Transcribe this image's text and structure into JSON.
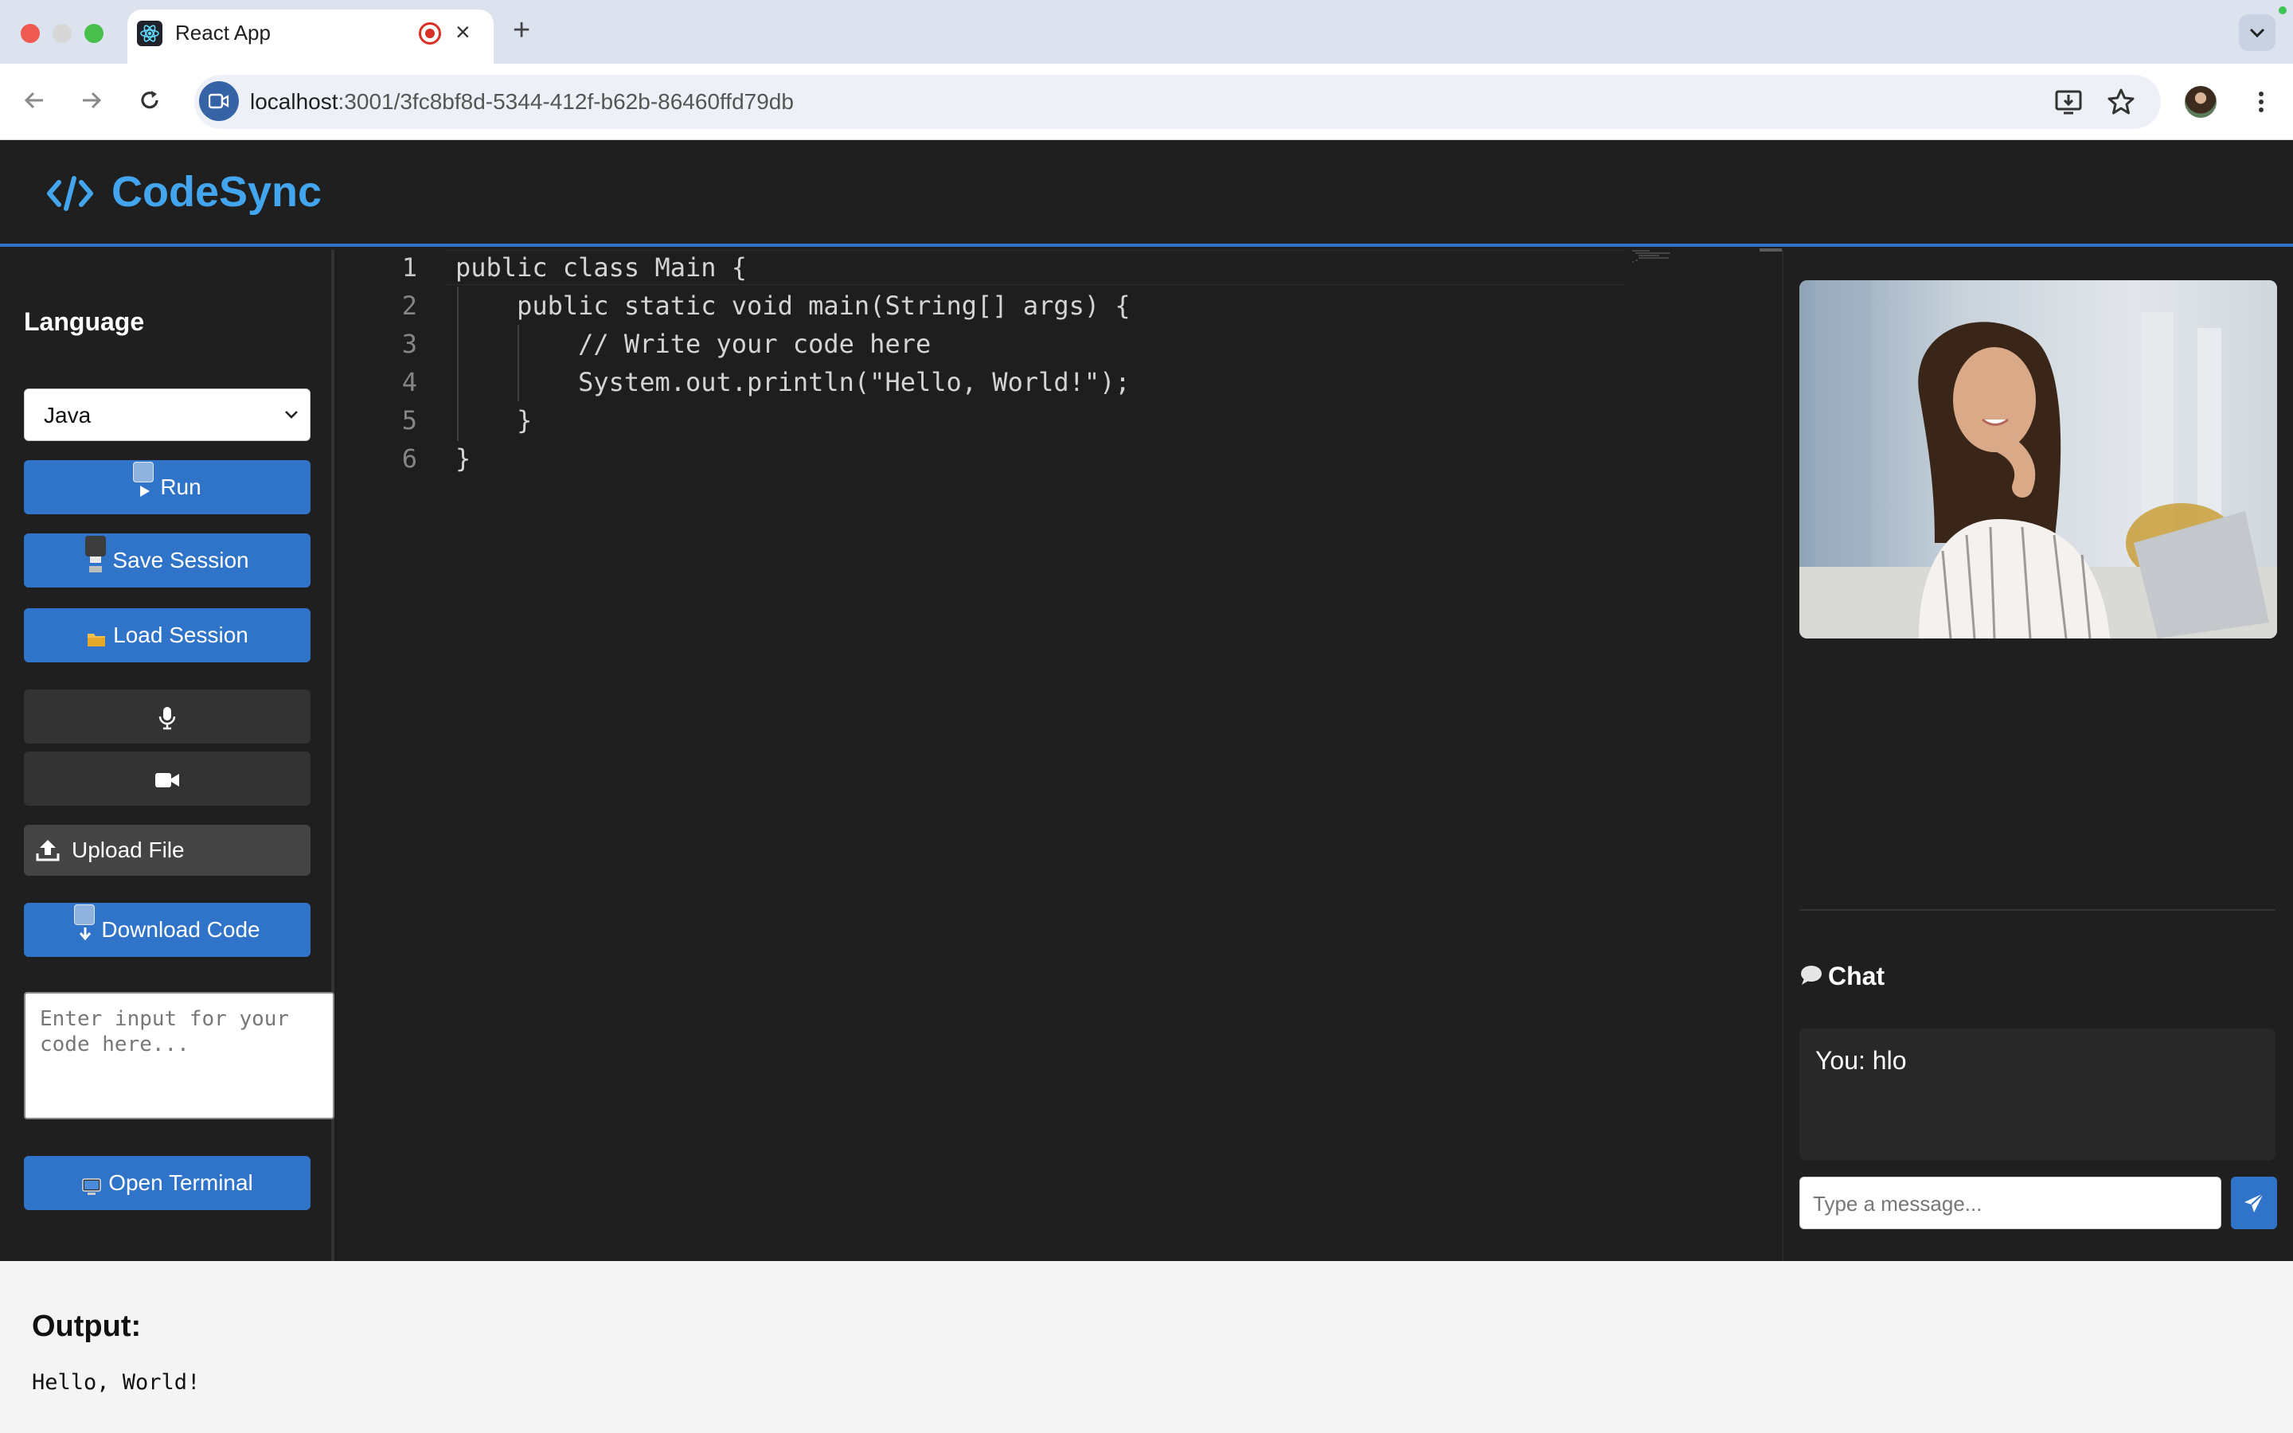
{
  "browser": {
    "tab_title": "React App",
    "url_host": "localhost",
    "url_path": ":3001/3fc8bf8d-5344-412f-b62b-86460ffd79db"
  },
  "app": {
    "name": "CodeSync",
    "accent": "#2f74c9",
    "logo_color": "#42a5ee"
  },
  "sidebar": {
    "language_label": "Language",
    "language_value": "Java",
    "run_label": "Run",
    "save_label": "Save Session",
    "load_label": "Load Session",
    "mic_icon": "microphone-icon",
    "camera_icon": "video-camera-icon",
    "upload_label": "Upload File",
    "download_label": "Download Code",
    "stdin_placeholder": "Enter input for your code here...",
    "terminal_label": "Open Terminal"
  },
  "editor": {
    "lines": [
      {
        "n": "1",
        "text": "public class Main {"
      },
      {
        "n": "2",
        "text": "    public static void main(String[] args) {"
      },
      {
        "n": "3",
        "text": "        // Write your code here"
      },
      {
        "n": "4",
        "text": "        System.out.println(\"Hello, World!\");"
      },
      {
        "n": "5",
        "text": "    }"
      },
      {
        "n": "6",
        "text": "}"
      }
    ]
  },
  "chat": {
    "title": "Chat",
    "messages": [
      "You: hlo"
    ],
    "input_placeholder": "Type a message..."
  },
  "output": {
    "title": "Output:",
    "text": "Hello, World!"
  }
}
